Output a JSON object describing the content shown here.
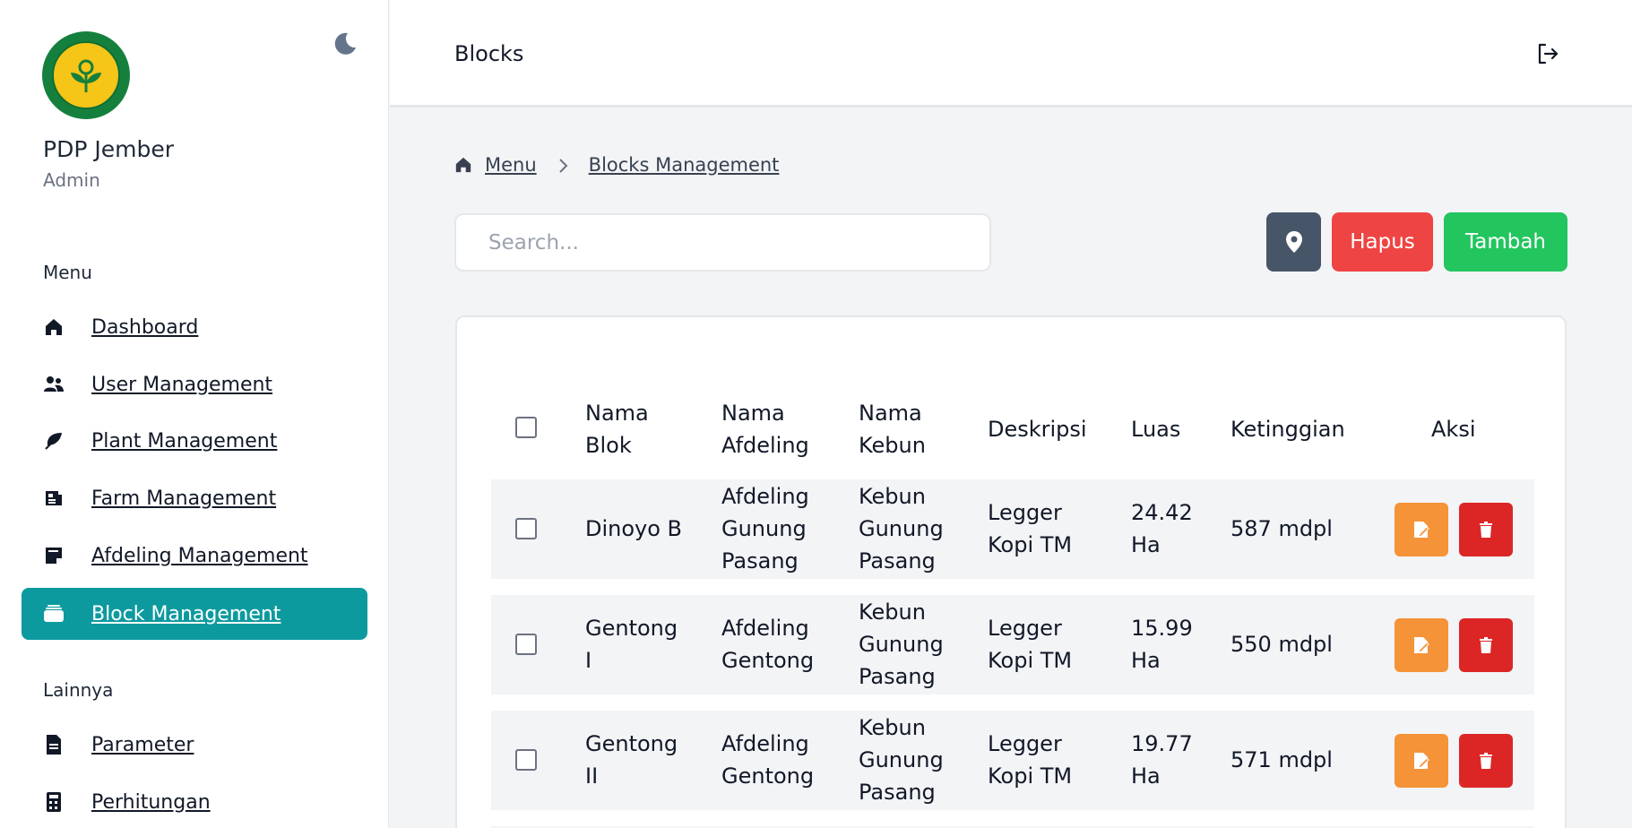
{
  "sidebar": {
    "org_name": "PDP Jember",
    "org_role": "Admin",
    "menu_label": "Menu",
    "other_label": "Lainnya",
    "items": [
      {
        "label": "Dashboard",
        "icon": "home-icon"
      },
      {
        "label": "User Management",
        "icon": "users-icon"
      },
      {
        "label": "Plant Management",
        "icon": "leaf-icon"
      },
      {
        "label": "Farm Management",
        "icon": "news-icon"
      },
      {
        "label": "Afdeling Management",
        "icon": "note-icon"
      },
      {
        "label": "Block Management",
        "icon": "layers-icon",
        "active": true
      }
    ],
    "other_items": [
      {
        "label": "Parameter",
        "icon": "file-icon"
      },
      {
        "label": "Perhitungan",
        "icon": "calculator-icon"
      }
    ]
  },
  "header": {
    "title": "Blocks"
  },
  "breadcrumb": {
    "home": "Menu",
    "current": "Blocks Management"
  },
  "search": {
    "placeholder": "Search...",
    "value": ""
  },
  "actions": {
    "map_icon": "map-pin-icon",
    "delete_label": "Hapus",
    "add_label": "Tambah"
  },
  "table": {
    "columns": {
      "nama_blok": [
        "Nama",
        "Blok"
      ],
      "nama_afdeling": [
        "Nama",
        "Afdeling"
      ],
      "nama_kebun": [
        "Nama",
        "Kebun"
      ],
      "deskripsi": "Deskripsi",
      "luas": "Luas",
      "ketinggian": "Ketinggian",
      "aksi": "Aksi"
    },
    "rows": [
      {
        "nama_blok": [
          "Dinoyo B"
        ],
        "nama_afdeling": [
          "Afdeling",
          "Gunung",
          "Pasang"
        ],
        "nama_kebun": [
          "Kebun",
          "Gunung",
          "Pasang"
        ],
        "deskripsi": [
          "Legger",
          "Kopi TM"
        ],
        "luas": [
          "24.42",
          "Ha"
        ],
        "ketinggian": "587 mdpl"
      },
      {
        "nama_blok": [
          "Gentong",
          "I"
        ],
        "nama_afdeling": [
          "Afdeling",
          "Gentong"
        ],
        "nama_kebun": [
          "Kebun",
          "Gunung",
          "Pasang"
        ],
        "deskripsi": [
          "Legger",
          "Kopi TM"
        ],
        "luas": [
          "15.99",
          "Ha"
        ],
        "ketinggian": "550 mdpl"
      },
      {
        "nama_blok": [
          "Gentong",
          "II"
        ],
        "nama_afdeling": [
          "Afdeling",
          "Gentong"
        ],
        "nama_kebun": [
          "Kebun",
          "Gunung",
          "Pasang"
        ],
        "deskripsi": [
          "Legger",
          "Kopi TM"
        ],
        "luas": [
          "19.77",
          "Ha"
        ],
        "ketinggian": "571 mdpl"
      }
    ]
  },
  "colors": {
    "active_nav": "#0d9a9f",
    "delete": "#ef4444",
    "add": "#22c55e",
    "edit": "#f59338"
  }
}
